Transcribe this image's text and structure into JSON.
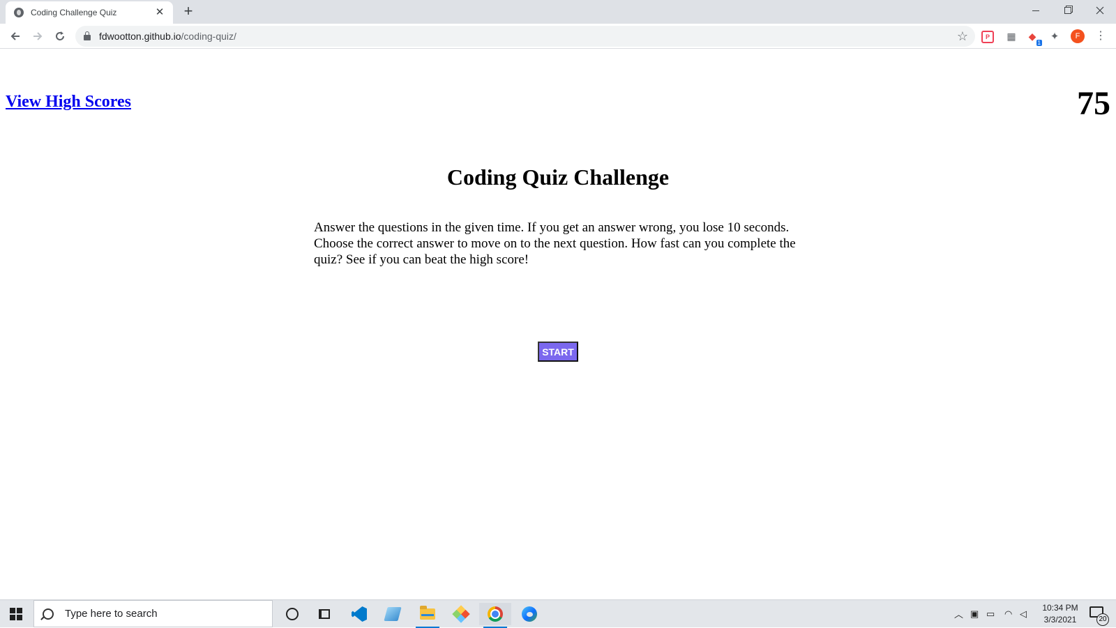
{
  "browser": {
    "tab_title": "Coding Challenge Quiz",
    "tab_close": "✕",
    "new_tab": "+",
    "url_host": "fdwootton.github.io",
    "url_path": "/coding-quiz/",
    "avatar_letter": "F",
    "extension_badge": "1"
  },
  "page": {
    "high_scores_link": "View High Scores",
    "timer": "75",
    "title": "Coding Quiz Challenge",
    "instructions": "Answer the questions in the given time. If you get an answer wrong, you lose 10 seconds. Choose the correct answer to move on to the next question. How fast can you complete the quiz? See if you can beat the high score!",
    "start_button": "START",
    "link_color": "#0000ee",
    "button_color": "#7b68ee"
  },
  "taskbar": {
    "search_placeholder": "Type here to search",
    "time": "10:34 PM",
    "date": "3/3/2021",
    "notification_count": "20",
    "pinned_apps": [
      "cortana",
      "task-view",
      "vscode",
      "notes",
      "file-explorer",
      "git",
      "chrome",
      "edge"
    ]
  }
}
